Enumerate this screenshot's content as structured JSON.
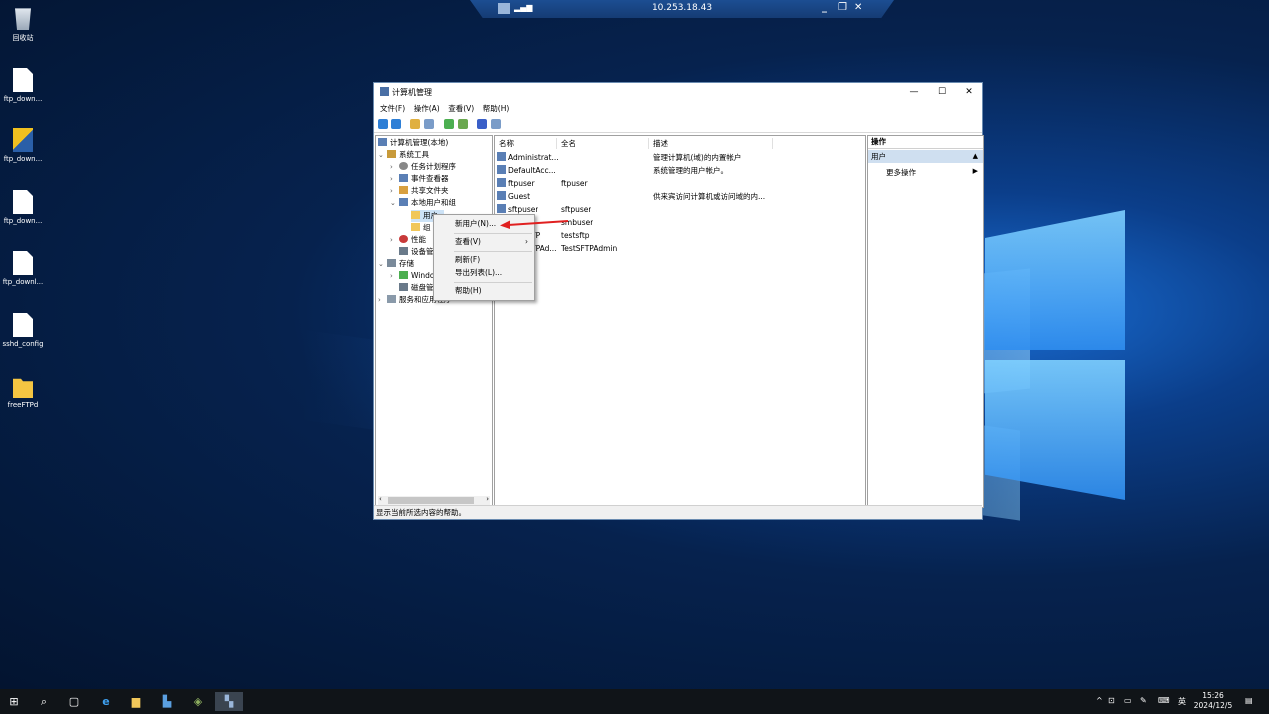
{
  "desktop_icons": [
    {
      "label": "回收站",
      "icon": "recycle-bin-icon"
    },
    {
      "label": "ftp_down...",
      "icon": "file-icon"
    },
    {
      "label": "ftp_down...",
      "icon": "installer-icon"
    },
    {
      "label": "ftp_down...",
      "icon": "file-icon"
    },
    {
      "label": "ftp_downl...",
      "icon": "file-icon"
    },
    {
      "label": "sshd_config",
      "icon": "file-icon"
    },
    {
      "label": "freeFTPd",
      "icon": "folder-shortcut-icon"
    }
  ],
  "rdp_bar": {
    "ip": "10.253.18.43"
  },
  "window": {
    "title": "计算机管理",
    "menu": [
      "文件(F)",
      "操作(A)",
      "查看(V)",
      "帮助(H)"
    ],
    "tree": [
      "计算机管理(本地)",
      "系统工具",
      "任务计划程序",
      "事件查看器",
      "共享文件夹",
      "本地用户和组",
      "用户",
      "组",
      "性能",
      "设备管理器",
      "存储",
      "Windows Server Backup",
      "磁盘管理",
      "服务和应用程序"
    ],
    "tree_display": [
      "计算机管理(本地)",
      "系统工具",
      "任务计划程序",
      "事件查看器",
      "共享文件夹",
      "本地用户和组",
      "用户",
      "组",
      "性能",
      "设备管",
      "存储",
      "Windo",
      "磁盘管",
      "服务和应用程序"
    ],
    "list_headers": [
      "名称",
      "全名",
      "描述"
    ],
    "list_rows": [
      {
        "name": "Administrat...",
        "full": "",
        "desc": "管理计算机(域)的内置帐户"
      },
      {
        "name": "DefaultAcc...",
        "full": "",
        "desc": "系统管理的用户帐户。"
      },
      {
        "name": "ftpuser",
        "full": "ftpuser",
        "desc": ""
      },
      {
        "name": "Guest",
        "full": "",
        "desc": "供来宾访问计算机或访问域的内..."
      },
      {
        "name": "sftpuser",
        "full": "sftpuser",
        "desc": ""
      },
      {
        "name": "",
        "full": "smbuser",
        "desc": ""
      },
      {
        "name": "TP",
        "full": "testsftp",
        "desc": ""
      },
      {
        "name": "TPAd...",
        "full": "TestSFTPAdmin",
        "desc": ""
      }
    ],
    "actions_header": "操作",
    "actions_selected": "用户",
    "actions_more": "更多操作",
    "status": "显示当前所选内容的帮助。"
  },
  "context_menu": {
    "items": [
      "新用户(N)...",
      "查看(V)",
      "刷新(F)",
      "导出列表(L)...",
      "帮助(H)"
    ]
  },
  "taskbar": {
    "time": "15:26",
    "date": "2024/12/5",
    "ime": "英"
  }
}
